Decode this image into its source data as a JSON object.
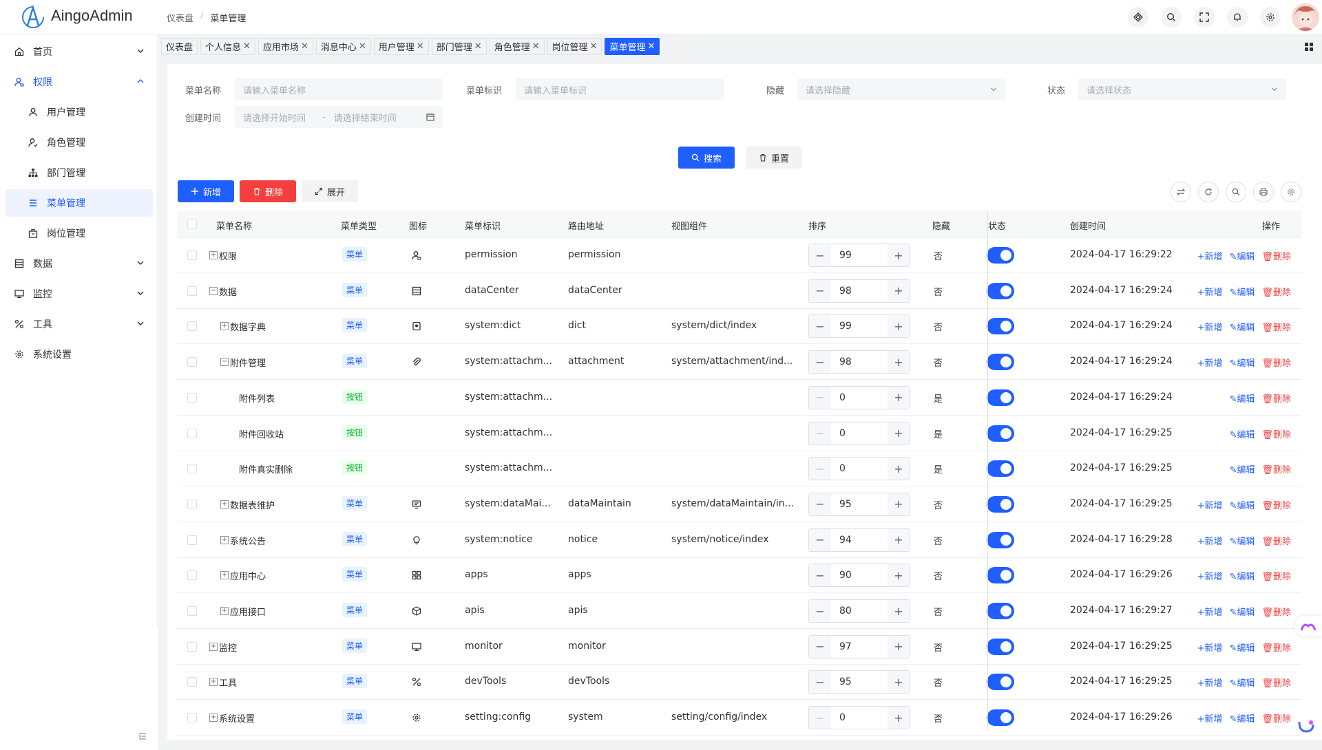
{
  "app": {
    "name": "AingoAdmin"
  },
  "breadcrumb": [
    "仪表盘",
    "菜单管理"
  ],
  "sidebar": {
    "items": [
      {
        "label": "首页",
        "icon": "home-icon"
      },
      {
        "label": "权限",
        "icon": "user-lock-icon"
      },
      {
        "label": "用户管理",
        "icon": "user-icon"
      },
      {
        "label": "角色管理",
        "icon": "user-role-icon"
      },
      {
        "label": "部门管理",
        "icon": "org-tree-icon"
      },
      {
        "label": "菜单管理",
        "icon": "menu-icon"
      },
      {
        "label": "岗位管理",
        "icon": "post-icon"
      },
      {
        "label": "数据",
        "icon": "data-icon"
      },
      {
        "label": "监控",
        "icon": "monitor-icon"
      },
      {
        "label": "工具",
        "icon": "tools-icon"
      },
      {
        "label": "系统设置",
        "icon": "settings-icon"
      }
    ]
  },
  "tabs": [
    "仪表盘",
    "个人信息",
    "应用市场",
    "消息中心",
    "用户管理",
    "部门管理",
    "角色管理",
    "岗位管理",
    "菜单管理"
  ],
  "filters": {
    "name_label": "菜单名称",
    "name_placeholder": "请输入菜单名称",
    "key_label": "菜单标识",
    "key_placeholder": "请输入菜单标识",
    "hidden_label": "隐藏",
    "hidden_placeholder": "请选择隐藏",
    "status_label": "状态",
    "status_placeholder": "请选择状态",
    "created_label": "创建时间",
    "start_placeholder": "请选择开始时间",
    "range_sep": "-",
    "end_placeholder": "请选择结束时间",
    "search": "搜索",
    "reset": "重置"
  },
  "toolbar": {
    "add": "新增",
    "delete": "删除",
    "expand": "展开"
  },
  "table": {
    "columns": [
      "菜单名称",
      "菜单类型",
      "图标",
      "菜单标识",
      "路由地址",
      "视图组件",
      "排序",
      "隐藏",
      "状态",
      "创建时间",
      "操作"
    ],
    "ops": {
      "add": "+新增",
      "edit": "✎编辑",
      "del": "删除"
    },
    "rows": [
      {
        "name": "权限",
        "level": 0,
        "tree": "+",
        "type": "菜单",
        "icon": "user-lock-icon",
        "key": "permission",
        "path": "permission",
        "component": "",
        "sort": "99",
        "hidden": "否",
        "created": "2024-04-17 16:29:22",
        "can_add": true
      },
      {
        "name": "数据",
        "level": 0,
        "tree": "−",
        "type": "菜单",
        "icon": "data-icon",
        "key": "dataCenter",
        "path": "dataCenter",
        "component": "",
        "sort": "98",
        "hidden": "否",
        "created": "2024-04-17 16:29:24",
        "can_add": true
      },
      {
        "name": "数据字典",
        "level": 1,
        "tree": "+",
        "type": "菜单",
        "icon": "dict-icon",
        "key": "system:dict",
        "path": "dict",
        "component": "system/dict/index",
        "sort": "99",
        "hidden": "否",
        "created": "2024-04-17 16:29:24",
        "can_add": true
      },
      {
        "name": "附件管理",
        "level": 1,
        "tree": "−",
        "type": "菜单",
        "icon": "attachment-icon",
        "key": "system:attachm...",
        "path": "attachment",
        "component": "system/attachment/ind...",
        "sort": "98",
        "hidden": "否",
        "created": "2024-04-17 16:29:24",
        "can_add": true
      },
      {
        "name": "附件列表",
        "level": 2,
        "tree": "",
        "type": "按钮",
        "icon": "",
        "key": "system:attachm...",
        "path": "",
        "component": "",
        "sort": "0",
        "hidden": "是",
        "created": "2024-04-17 16:29:24",
        "can_add": false
      },
      {
        "name": "附件回收站",
        "level": 2,
        "tree": "",
        "type": "按钮",
        "icon": "",
        "key": "system:attachm...",
        "path": "",
        "component": "",
        "sort": "0",
        "hidden": "是",
        "created": "2024-04-17 16:29:25",
        "can_add": false
      },
      {
        "name": "附件真实删除",
        "level": 2,
        "tree": "",
        "type": "按钮",
        "icon": "",
        "key": "system:attachm...",
        "path": "",
        "component": "",
        "sort": "0",
        "hidden": "是",
        "created": "2024-04-17 16:29:25",
        "can_add": false
      },
      {
        "name": "数据表维护",
        "level": 1,
        "tree": "+",
        "type": "菜单",
        "icon": "db-maintain-icon",
        "key": "system:dataMai...",
        "path": "dataMaintain",
        "component": "system/dataMaintain/in...",
        "sort": "95",
        "hidden": "否",
        "created": "2024-04-17 16:29:25",
        "can_add": true
      },
      {
        "name": "系统公告",
        "level": 1,
        "tree": "+",
        "type": "菜单",
        "icon": "bulb-icon",
        "key": "system:notice",
        "path": "notice",
        "component": "system/notice/index",
        "sort": "94",
        "hidden": "否",
        "created": "2024-04-17 16:29:28",
        "can_add": true
      },
      {
        "name": "应用中心",
        "level": 1,
        "tree": "+",
        "type": "菜单",
        "icon": "apps-icon",
        "key": "apps",
        "path": "apps",
        "component": "",
        "sort": "90",
        "hidden": "否",
        "created": "2024-04-17 16:29:26",
        "can_add": true
      },
      {
        "name": "应用接口",
        "level": 1,
        "tree": "+",
        "type": "菜单",
        "icon": "cube-icon",
        "key": "apis",
        "path": "apis",
        "component": "",
        "sort": "80",
        "hidden": "否",
        "created": "2024-04-17 16:29:27",
        "can_add": true
      },
      {
        "name": "监控",
        "level": 0,
        "tree": "+",
        "type": "菜单",
        "icon": "monitor-icon",
        "key": "monitor",
        "path": "monitor",
        "component": "",
        "sort": "97",
        "hidden": "否",
        "created": "2024-04-17 16:29:25",
        "can_add": true
      },
      {
        "name": "工具",
        "level": 0,
        "tree": "+",
        "type": "菜单",
        "icon": "tools-icon",
        "key": "devTools",
        "path": "devTools",
        "component": "",
        "sort": "95",
        "hidden": "否",
        "created": "2024-04-17 16:29:25",
        "can_add": true
      },
      {
        "name": "系统设置",
        "level": 0,
        "tree": "+",
        "type": "菜单",
        "icon": "settings-icon",
        "key": "setting:config",
        "path": "system",
        "component": "setting/config/index",
        "sort": "0",
        "hidden": "否",
        "created": "2024-04-17 16:29:26",
        "can_add": true
      }
    ]
  },
  "colors": {
    "primary": "#1f5eff",
    "danger": "#f53f3f",
    "success": "#00b42a"
  }
}
